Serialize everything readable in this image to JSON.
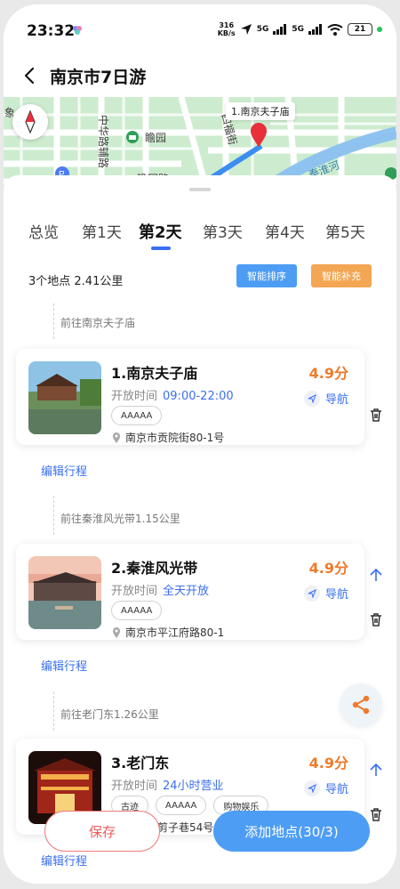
{
  "status_bar": {
    "time": "23:32",
    "speed_value": "316",
    "speed_unit": "KB/s",
    "net1": "5G",
    "net2": "5G",
    "battery": "21"
  },
  "header": {
    "title": "南京市7日游"
  },
  "map": {
    "pin_label": "1.南京夫子庙",
    "labels": [
      "中华路辅路",
      "瞻园",
      "四福街",
      "秦淮河",
      "象",
      "瞻园路"
    ],
    "icon_names": [
      "compass-icon",
      "location-pin-icon",
      "park-icon",
      "parking-icon"
    ]
  },
  "tabs": [
    {
      "label": "总览",
      "active": false
    },
    {
      "label": "第1天",
      "active": false
    },
    {
      "label": "第2天",
      "active": true
    },
    {
      "label": "第3天",
      "active": false
    },
    {
      "label": "第4天",
      "active": false
    },
    {
      "label": "第5天",
      "active": false
    }
  ],
  "summary": {
    "text": "3个地点 2.41公里",
    "smart_sort": "智能排序",
    "smart_fill": "智能补充"
  },
  "stops": [
    {
      "route": "前往南京夫子庙",
      "name": "1.南京夫子庙",
      "score": "4.9分",
      "open_label": "开放时间",
      "open_time": "09:00-22:00",
      "tags": [
        "AAAAA"
      ],
      "address": "南京市贡院街80-1号",
      "nav": "导航",
      "edit": "编辑行程"
    },
    {
      "route": "前往秦淮风光带1.15公里",
      "name": "2.秦淮风光带",
      "score": "4.9分",
      "open_label": "开放时间",
      "open_time": "全天开放",
      "tags": [
        "AAAAA"
      ],
      "address": "南京市平江府路80-1",
      "nav": "导航",
      "edit": "编辑行程"
    },
    {
      "route": "前往老门东1.26公里",
      "name": "3.老门东",
      "score": "4.9分",
      "open_label": "开放时间",
      "open_time": "24小时营业",
      "tags": [
        "古迹",
        "AAAAA",
        "购物娱乐"
      ],
      "address": "南京市剪子巷54号",
      "nav": "导航",
      "edit": "编辑行程"
    }
  ],
  "footer": {
    "save": "保存",
    "add": "添加地点(30/3)"
  },
  "colors": {
    "accent": "#3a6ff2",
    "score": "#ef7a2a",
    "smart_sort": "#4d9df5",
    "smart_fill": "#f3a653",
    "save": "#ef5a5a",
    "share_icon": "#f07a2e"
  }
}
